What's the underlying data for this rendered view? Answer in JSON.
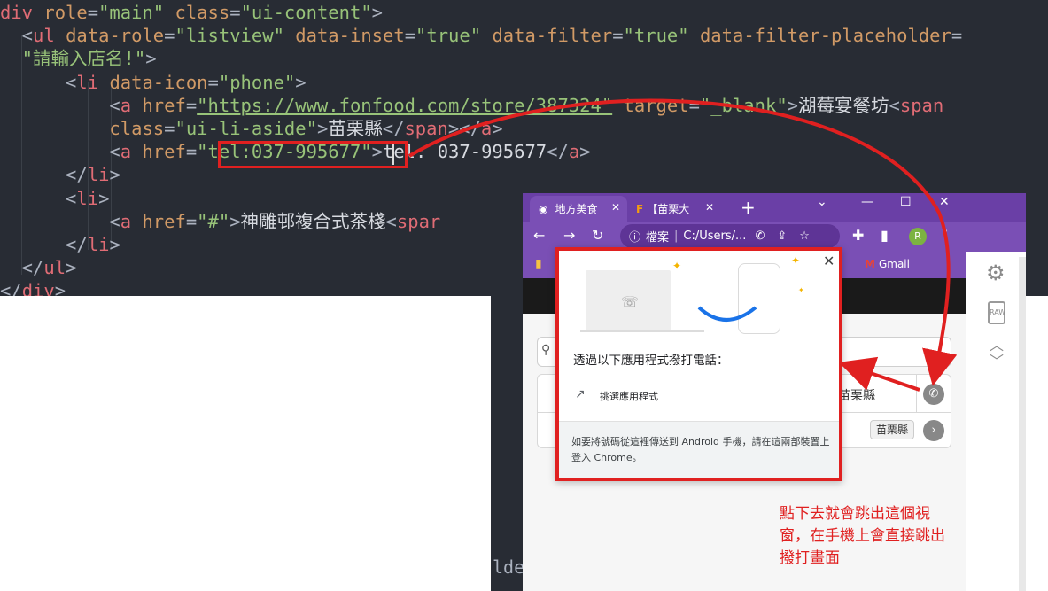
{
  "editor": {
    "lines": [
      {
        "indent_guides": 0,
        "tokens": [
          {
            "t": "tag",
            "v": "div "
          },
          {
            "t": "attr",
            "v": "role"
          },
          {
            "t": "pun",
            "v": "="
          },
          {
            "t": "str",
            "v": "\"main\" "
          },
          {
            "t": "attr",
            "v": "class"
          },
          {
            "t": "pun",
            "v": "="
          },
          {
            "t": "str",
            "v": "\"ui-content\""
          },
          {
            "t": "pun",
            "v": ">"
          }
        ]
      },
      {
        "tokens": [
          {
            "t": "pun",
            "v": "  <"
          },
          {
            "t": "tag",
            "v": "ul "
          },
          {
            "t": "attr",
            "v": "data-role"
          },
          {
            "t": "pun",
            "v": "="
          },
          {
            "t": "str",
            "v": "\"listview\" "
          },
          {
            "t": "attr",
            "v": "data-inset"
          },
          {
            "t": "pun",
            "v": "="
          },
          {
            "t": "str",
            "v": "\"true\" "
          },
          {
            "t": "attr",
            "v": "data-filter"
          },
          {
            "t": "pun",
            "v": "="
          },
          {
            "t": "str",
            "v": "\"true\" "
          },
          {
            "t": "attr",
            "v": "data-filter-placeholder"
          },
          {
            "t": "pun",
            "v": "="
          }
        ]
      },
      {
        "tokens": [
          {
            "t": "str",
            "v": "  \"請輸入店名!\""
          },
          {
            "t": "pun",
            "v": ">"
          }
        ]
      },
      {
        "tokens": [
          {
            "t": "pun",
            "v": "      <"
          },
          {
            "t": "tag",
            "v": "li "
          },
          {
            "t": "attr",
            "v": "data-icon"
          },
          {
            "t": "pun",
            "v": "="
          },
          {
            "t": "str",
            "v": "\"phone\""
          },
          {
            "t": "pun",
            "v": ">"
          }
        ]
      },
      {
        "tokens": [
          {
            "t": "pun",
            "v": "          <"
          },
          {
            "t": "tag",
            "v": "a "
          },
          {
            "t": "attr",
            "v": "href"
          },
          {
            "t": "pun",
            "v": "="
          },
          {
            "t": "url",
            "v": "\"https://www.fonfood.com/store/387324\""
          },
          {
            "t": "pun",
            "v": " "
          },
          {
            "t": "attr",
            "v": "target"
          },
          {
            "t": "pun",
            "v": "="
          },
          {
            "t": "str",
            "v": "\"_blank\""
          },
          {
            "t": "pun",
            "v": ">"
          },
          {
            "t": "txt",
            "v": "湖莓宴餐坊"
          },
          {
            "t": "pun",
            "v": "<"
          },
          {
            "t": "tag",
            "v": "span"
          }
        ]
      },
      {
        "tokens": [
          {
            "t": "attr",
            "v": "          class"
          },
          {
            "t": "pun",
            "v": "="
          },
          {
            "t": "str",
            "v": "\"ui-li-aside\""
          },
          {
            "t": "pun",
            "v": ">"
          },
          {
            "t": "txt",
            "v": "苗栗縣"
          },
          {
            "t": "pun",
            "v": "</"
          },
          {
            "t": "tag",
            "v": "span"
          },
          {
            "t": "pun",
            "v": "></"
          },
          {
            "t": "tag",
            "v": "a"
          },
          {
            "t": "pun",
            "v": ">"
          }
        ]
      },
      {
        "tokens": [
          {
            "t": "pun",
            "v": "          <"
          },
          {
            "t": "tag",
            "v": "a "
          },
          {
            "t": "attr",
            "v": "href"
          },
          {
            "t": "pun",
            "v": "="
          },
          {
            "t": "str",
            "v": "\"tel:037-995677\""
          },
          {
            "t": "pun",
            "v": ">"
          },
          {
            "t": "txt",
            "v": "tel: 037-995677"
          },
          {
            "t": "pun",
            "v": "</"
          },
          {
            "t": "tag",
            "v": "a"
          },
          {
            "t": "pun",
            "v": ">"
          }
        ]
      },
      {
        "tokens": [
          {
            "t": "pun",
            "v": "      </"
          },
          {
            "t": "tag",
            "v": "li"
          },
          {
            "t": "pun",
            "v": ">"
          }
        ]
      },
      {
        "tokens": [
          {
            "t": "pun",
            "v": "      <"
          },
          {
            "t": "tag",
            "v": "li"
          },
          {
            "t": "pun",
            "v": ">"
          }
        ]
      },
      {
        "tokens": [
          {
            "t": "pun",
            "v": "          <"
          },
          {
            "t": "tag",
            "v": "a "
          },
          {
            "t": "attr",
            "v": "href"
          },
          {
            "t": "pun",
            "v": "="
          },
          {
            "t": "str",
            "v": "\"#\""
          },
          {
            "t": "pun",
            "v": ">"
          },
          {
            "t": "txt",
            "v": "神雕邨複合式茶棧"
          },
          {
            "t": "pun",
            "v": "<"
          },
          {
            "t": "tag",
            "v": "spar"
          }
        ]
      },
      {
        "tokens": [
          {
            "t": "pun",
            "v": "      </"
          },
          {
            "t": "tag",
            "v": "li"
          },
          {
            "t": "pun",
            "v": ">"
          }
        ]
      },
      {
        "tokens": [
          {
            "t": "pun",
            "v": "  </"
          },
          {
            "t": "tag",
            "v": "ul"
          },
          {
            "t": "pun",
            "v": ">"
          }
        ]
      },
      {
        "tokens": [
          {
            "t": "pun",
            "v": "</"
          },
          {
            "t": "tag",
            "v": "div"
          },
          {
            "t": "pun",
            "v": ">"
          }
        ]
      }
    ],
    "bottom_fragment": "lde"
  },
  "browser": {
    "tabs": [
      {
        "label": "地方美食",
        "close": "✕",
        "active": true
      },
      {
        "label": "【苗栗大",
        "close": "✕",
        "active": false
      }
    ],
    "new_tab": "+",
    "window_controls": {
      "chevron": "⌄",
      "minimize": "—",
      "maximize": "☐",
      "close": "✕"
    },
    "address": {
      "info": "ⓘ",
      "prefix": "檔案",
      "url": "C:/Users/..."
    },
    "profile_initial": "R",
    "bookmark_gmail": "Gmail",
    "list": {
      "row1_aside": "苗栗縣",
      "row2_aside": "苗栗縣"
    },
    "side_panel": {
      "raw_label": "RAW"
    }
  },
  "popup": {
    "title": "透過以下應用程式撥打電話：",
    "app_option": "挑選應用程式",
    "footer": "如要將號碼從這裡傳送到 Android 手機，請在這兩部裝置上登入 Chrome。",
    "close": "✕"
  },
  "annotation": {
    "text": "點下去就會跳出這個視窗，在手機上會直接跳出撥打畫面",
    "color": "#e02020"
  },
  "colors": {
    "editor_bg": "#282c34",
    "tag": "#e06c75",
    "attr": "#d19a66",
    "string": "#98c379",
    "chrome_purple": "#7a4fb5",
    "highlight_red": "#e02020"
  }
}
